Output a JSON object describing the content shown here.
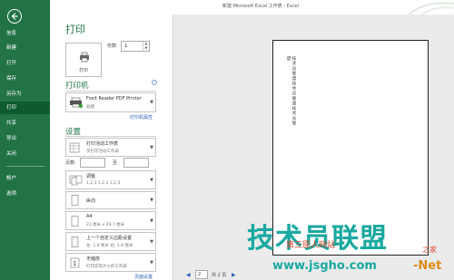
{
  "window": {
    "title": "新建 Microsoft Excel 工作表 - Excel"
  },
  "sidebar": {
    "items": [
      {
        "label": "信息"
      },
      {
        "label": "新建"
      },
      {
        "label": "打开"
      },
      {
        "label": "保存"
      },
      {
        "label": "另存为"
      },
      {
        "label": "打印"
      },
      {
        "label": "共享"
      },
      {
        "label": "导出"
      },
      {
        "label": "关闭"
      },
      {
        "label": "帐户"
      },
      {
        "label": "选项"
      }
    ]
  },
  "print": {
    "title": "打印",
    "print_button_label": "打印",
    "copies_label": "份数:",
    "copies_value": "1"
  },
  "printer": {
    "section_title": "打印机",
    "name": "Foxit Reader PDF Printer",
    "status": "就绪",
    "properties_link": "打印机属性"
  },
  "settings": {
    "section_title": "设置",
    "scope": {
      "title": "打印活动工作表",
      "subtitle": "仅打印活动工作表"
    },
    "pages_label": "页数:",
    "to_label": "至",
    "collate": {
      "title": "调整",
      "subtitle": "1,2,3    1,2,3    1,2,3"
    },
    "orientation": {
      "title": "纵向"
    },
    "paper": {
      "title": "A4",
      "subtitle": "21 厘米 x 29.7 厘米"
    },
    "margins": {
      "title": "上一个自定义边距设置",
      "subtitle": "左: 1.8 厘米    右: 1.8 厘米"
    },
    "scaling": {
      "title": "无缩放",
      "subtitle": "打印实际大小的工作表"
    },
    "page_setup_link": "页面设置"
  },
  "preview": {
    "page_text": "技术员联盟技术员联盟技术员联盟",
    "current_page": "2",
    "total_pages": "共 2 页"
  },
  "watermark": {
    "main": "技术员联盟",
    "sub": "第三原人网站",
    "url": "www.jsgho.com",
    "net": "-Net",
    "home": "之家"
  },
  "colors": {
    "excel_green": "#217346",
    "active_nav": "#0f5a2f",
    "link": "#2a62b0"
  }
}
